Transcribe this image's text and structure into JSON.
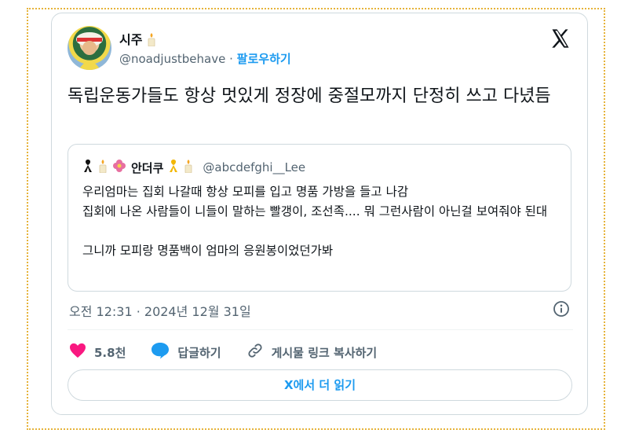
{
  "tweet": {
    "author_name": "시주",
    "author_handle": "@noadjustbehave",
    "separator": "·",
    "follow_label": "팔로우하기",
    "text": "독립운동가들도 항상 멋있게 정장에 중절모까지 단정히 쓰고 다녔듬",
    "timestamp": "오전 12:31 · 2024년 12월 31일"
  },
  "quote": {
    "author_name": "안더쿠",
    "author_handle": "@abcdefghi__Lee",
    "lines": [
      "우리엄마는 집회 나갈때 항상 모피를 입고 명품 가방을 들고 나감",
      "집회에 나온 사람들이 니들이 말하는 빨갱이, 조선족.... 뭐 그런사람이 아닌걸 보여줘야 된대",
      "그니까 모피랑 명품백이 엄마의 응원봉이었던가봐"
    ]
  },
  "actions": {
    "like_count": "5.8천",
    "reply_label": "답글하기",
    "copy_link_label": "게시물 링크 복사하기"
  },
  "read_more_label": "X에서 더 읽기",
  "colors": {
    "accent": "#1d9bf0",
    "like": "#f91880",
    "muted": "#536471",
    "frame": "#e6b33a"
  }
}
